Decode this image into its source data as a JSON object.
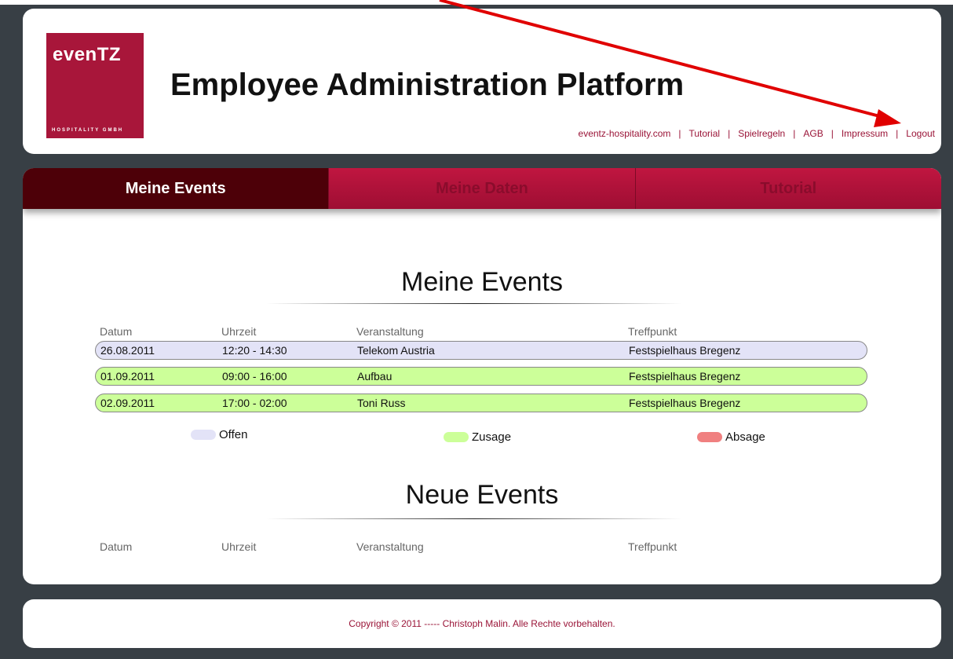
{
  "header": {
    "logo": {
      "brand": "evenTZ",
      "subtitle": "HOSPITALITY GMBH"
    },
    "title": "Employee Administration Platform",
    "nav": [
      {
        "label": "eventz-hospitality.com"
      },
      {
        "label": "Tutorial"
      },
      {
        "label": "Spielregeln"
      },
      {
        "label": "AGB"
      },
      {
        "label": "Impressum"
      },
      {
        "label": "Logout"
      }
    ],
    "nav_separator": "|"
  },
  "tabs": [
    {
      "label": "Meine Events",
      "active": true
    },
    {
      "label": "Meine Daten",
      "active": false
    },
    {
      "label": "Tutorial",
      "active": false
    }
  ],
  "my_events": {
    "title": "Meine Events",
    "columns": [
      "Datum",
      "Uhrzeit",
      "Veranstaltung",
      "Treffpunkt"
    ],
    "rows": [
      {
        "date": "26.08.2011",
        "time": "12:20 - 14:30",
        "event": "Telekom Austria",
        "meeting_point": "Festspielhaus Bregenz",
        "status": "offen"
      },
      {
        "date": "01.09.2011",
        "time": "09:00 - 16:00",
        "event": "Aufbau",
        "meeting_point": "Festspielhaus Bregenz",
        "status": "zusage"
      },
      {
        "date": "02.09.2011",
        "time": "17:00 - 02:00",
        "event": "Toni Russ",
        "meeting_point": "Festspielhaus Bregenz",
        "status": "zusage"
      }
    ]
  },
  "legend": [
    {
      "label": "Offen",
      "color": "#e3e3f7"
    },
    {
      "label": "Zusage",
      "color": "#ccff99"
    },
    {
      "label": "Absage",
      "color": "#f08080"
    }
  ],
  "new_events": {
    "title": "Neue Events",
    "columns": [
      "Datum",
      "Uhrzeit",
      "Veranstaltung",
      "Treffpunkt"
    ]
  },
  "footer": {
    "copyright": "Copyright © 2011 ----- Christoph Malin. Alle Rechte vorbehalten."
  },
  "colors": {
    "brand": "#a8163a",
    "tab_active": "#4d0008",
    "tab_inactive": "#b01238",
    "link": "#9a1437",
    "page_background": "#383f45",
    "annotation_arrow": "#e00000"
  }
}
